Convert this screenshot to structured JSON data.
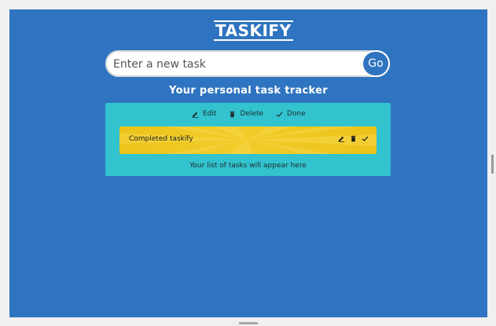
{
  "app": {
    "logo": "TASKIFY",
    "tagline": "Your personal task tracker"
  },
  "search": {
    "placeholder": "Enter a new task",
    "go_label": "Go"
  },
  "legend": {
    "edit_label": "Edit",
    "delete_label": "Delete",
    "done_label": "Done"
  },
  "tasks": [
    {
      "text": "Completed taskify"
    }
  ],
  "footer": {
    "hint": "Your list of tasks will appear here"
  },
  "colors": {
    "background": "#2f74c0",
    "panel": "#32c3cf",
    "task_card": "#ecc31a",
    "frame": "#f0f0f0"
  },
  "icons": {
    "edit": "pencil-icon",
    "delete": "trash-icon",
    "done": "check-icon"
  }
}
